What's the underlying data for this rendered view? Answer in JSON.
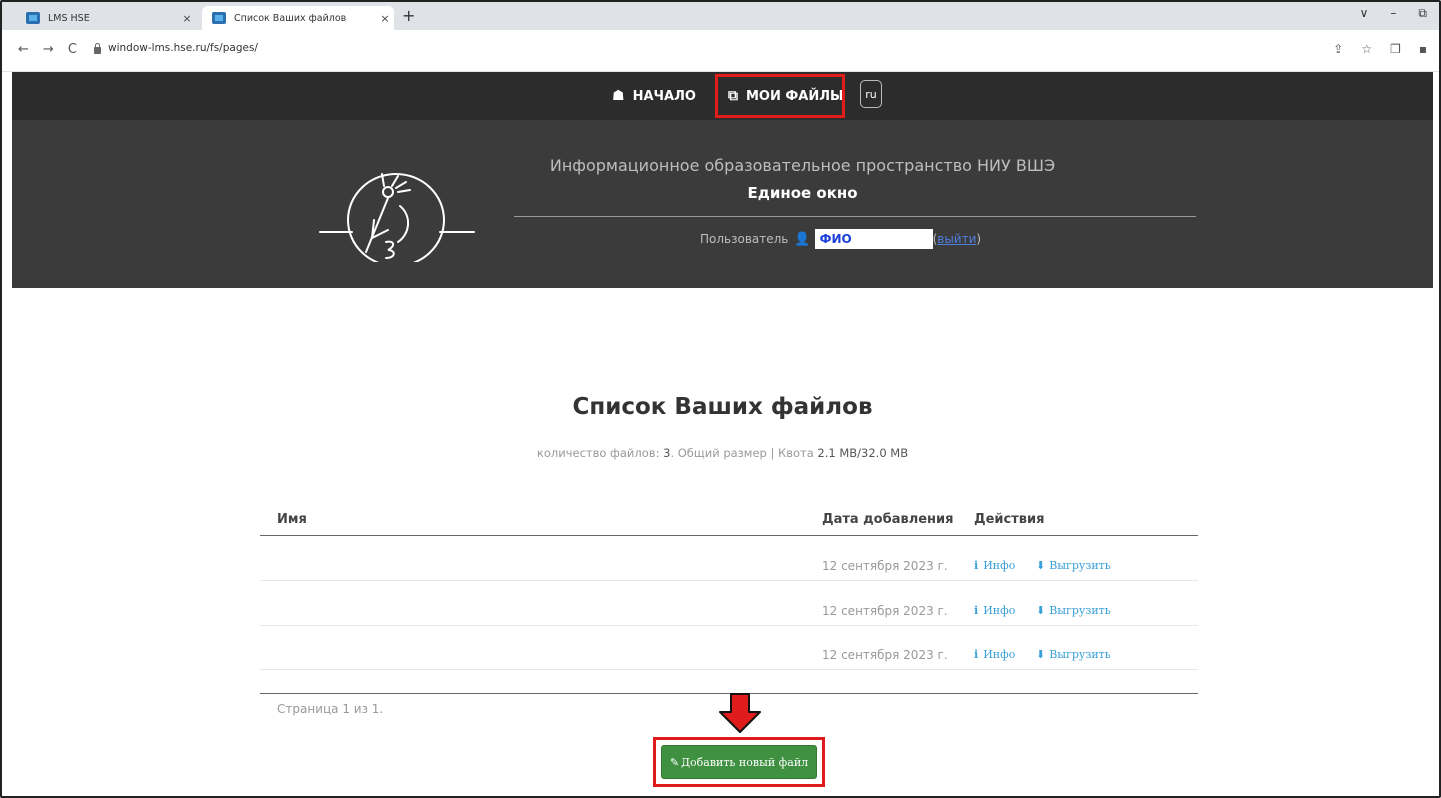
{
  "browser": {
    "tabs": [
      {
        "title": "LMS HSE",
        "close": "×"
      },
      {
        "title": "Список Ваших файлов",
        "close": "×"
      }
    ],
    "new_tab": "+",
    "window_controls": {
      "chevron": "∨",
      "minimize": "–",
      "restore": "⧉"
    },
    "nav": {
      "back": "←",
      "forward": "→",
      "reload": "C"
    },
    "url": "window-lms.hse.ru/fs/pages/",
    "right_icons": [
      "⇪",
      "☆",
      "❒",
      "▪"
    ]
  },
  "topnav": {
    "home_icon": "☗",
    "home_label": "НАЧАЛО",
    "files_icon": "⧉",
    "files_label": "МОИ ФАЙЛЫ",
    "lang_label": "ru"
  },
  "hero": {
    "title": "Информационное образовательное пространство НИУ ВШЭ",
    "subtitle": "Единое окно",
    "user_label": "Пользователь",
    "user_icon": "👤",
    "user_name": "ФИО",
    "logout_open": "(",
    "logout_label": "выйти",
    "logout_close": ")"
  },
  "main": {
    "title": "Список Ваших файлов",
    "stats_prefix": "количество файлов: ",
    "stats_count": "3",
    "stats_mid": ". Общий размер | Квота ",
    "stats_size": "2.1 MB/32.0 MB",
    "table": {
      "headers": {
        "name": "Имя",
        "date": "Дата добавления",
        "actions": "Действия"
      },
      "rows": [
        {
          "name": "",
          "date": "12 сентября 2023 г.",
          "info": "Инфо",
          "upload": "Выгрузить"
        },
        {
          "name": "",
          "date": "12 сентября 2023 г.",
          "info": "Инфо",
          "upload": "Выгрузить"
        },
        {
          "name": "",
          "date": "12 сентября 2023 г.",
          "info": "Инфо",
          "upload": "Выгрузить"
        }
      ],
      "info_icon": "i",
      "upload_icon": "⬇"
    },
    "pagination": "Страница 1 из 1.",
    "add_icon": "✎",
    "add_label": "Добавить новый файл"
  },
  "annotation": {
    "arrow_color": "#e01b1b"
  }
}
